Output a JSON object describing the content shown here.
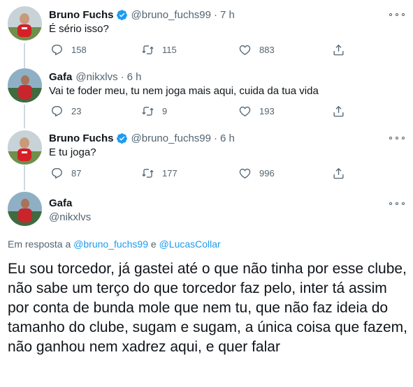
{
  "tweets": [
    {
      "name": "Bruno Fuchs",
      "verified": true,
      "handle": "@bruno_fuchs99",
      "sep": "·",
      "time": "7 h",
      "text": "É sério isso?",
      "replies": "158",
      "retweets": "115",
      "likes": "883"
    },
    {
      "name": "Gafa",
      "verified": false,
      "handle": "@nikxlvs",
      "sep": "·",
      "time": "6 h",
      "text": "Vai te foder meu, tu nem joga mais aqui, cuida da tua vida",
      "replies": "23",
      "retweets": "9",
      "likes": "193"
    },
    {
      "name": "Bruno Fuchs",
      "verified": true,
      "handle": "@bruno_fuchs99",
      "sep": "·",
      "time": "6 h",
      "text": "E tu joga?",
      "replies": "87",
      "retweets": "177",
      "likes": "996"
    }
  ],
  "main_tweet": {
    "name": "Gafa",
    "handle": "@nikxlvs",
    "reply_prefix": "Em resposta a",
    "reply_user1": "@bruno_fuchs99",
    "reply_joiner": "e",
    "reply_user2": "@LucasCollar",
    "text": "Eu sou torcedor, já gastei até o que não tinha por esse clube, não sabe um terço do que torcedor faz pelo, inter tá assim por conta de bunda mole que nem tu, que não faz ideia do tamanho do clube, sugam e sugam, a única coisa que fazem, não ganhou nem xadrez aqui, e quer falar"
  },
  "colors": {
    "text": "#0f1419",
    "secondary": "#536471",
    "link": "#1d9bf0",
    "verified": "#1d9bf0",
    "thread_line": "#cfd9de"
  },
  "icons": [
    "reply-icon",
    "retweet-icon",
    "like-icon",
    "share-icon",
    "more-icon",
    "verified-icon"
  ]
}
